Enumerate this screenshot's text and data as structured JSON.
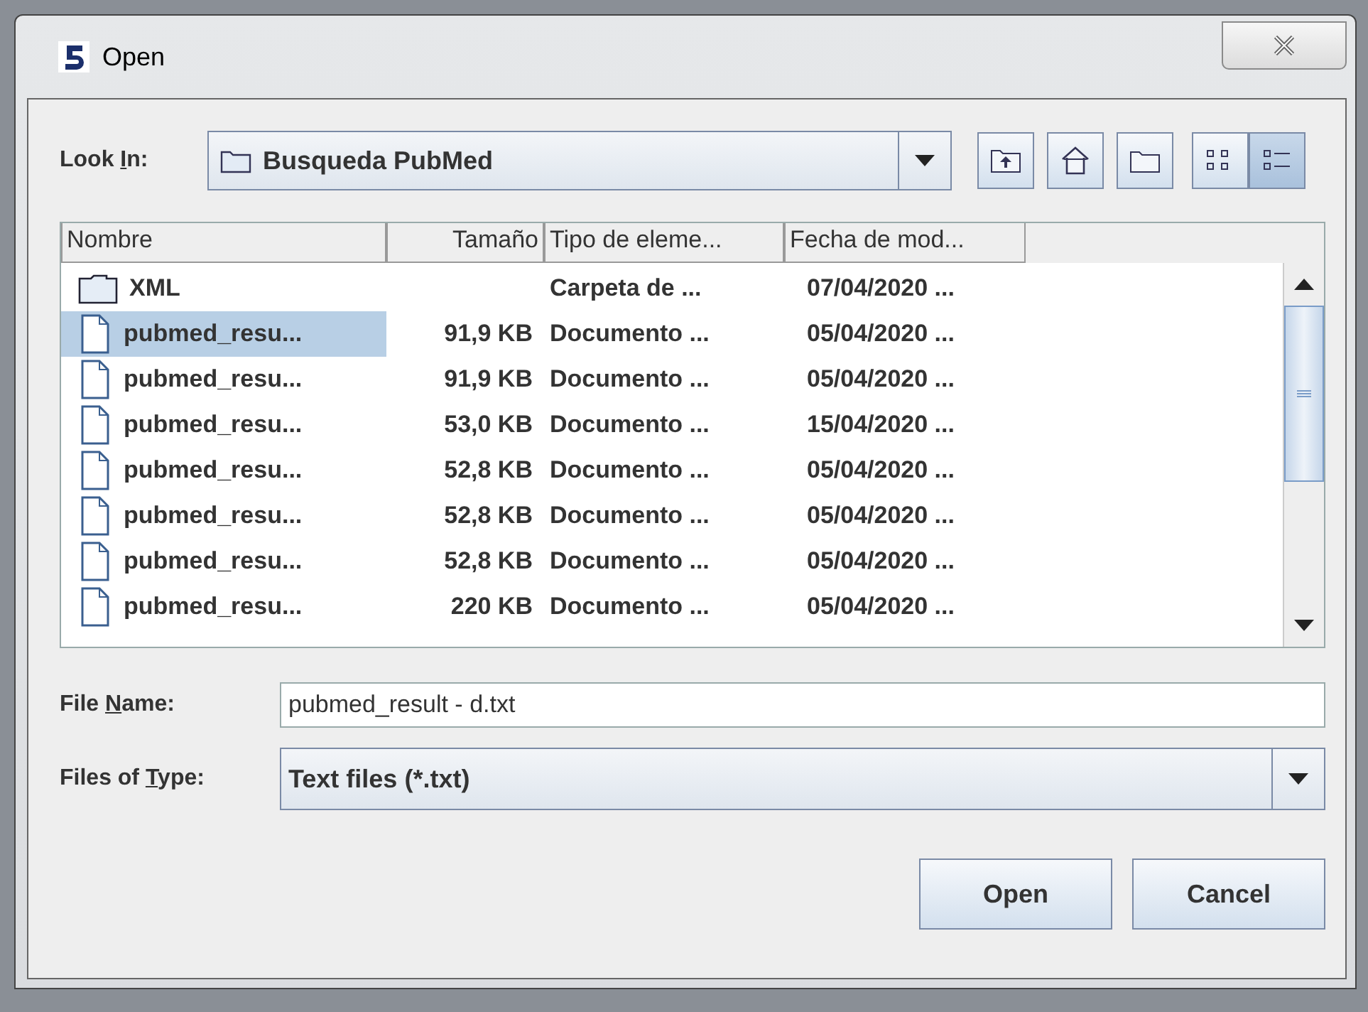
{
  "window": {
    "title": "Open"
  },
  "look_in": {
    "label_parts": [
      "Look ",
      "I",
      "n:"
    ],
    "value": "Busqueda PubMed"
  },
  "toolbar": [
    {
      "kind": "up",
      "selected": false
    },
    {
      "kind": "home",
      "selected": false
    },
    {
      "kind": "new-folder",
      "selected": false
    },
    {
      "kind": "list",
      "selected": false
    },
    {
      "kind": "details",
      "selected": true
    }
  ],
  "table": {
    "columns": [
      "Nombre",
      "Tamaño",
      "Tipo de eleme...",
      "Fecha de mod..."
    ],
    "rows": [
      {
        "kind": "folder",
        "name": "XML",
        "size": "",
        "type": "Carpeta de ...",
        "date": "07/04/2020 ...",
        "selected": false
      },
      {
        "kind": "file",
        "name": "pubmed_resu...",
        "size": "91,9 KB",
        "type": "Documento ...",
        "date": "05/04/2020 ...",
        "selected": true
      },
      {
        "kind": "file",
        "name": "pubmed_resu...",
        "size": "91,9 KB",
        "type": "Documento ...",
        "date": "05/04/2020 ...",
        "selected": false
      },
      {
        "kind": "file",
        "name": "pubmed_resu...",
        "size": "53,0 KB",
        "type": "Documento ...",
        "date": "15/04/2020 ...",
        "selected": false
      },
      {
        "kind": "file",
        "name": "pubmed_resu...",
        "size": "52,8 KB",
        "type": "Documento ...",
        "date": "05/04/2020 ...",
        "selected": false
      },
      {
        "kind": "file",
        "name": "pubmed_resu...",
        "size": "52,8 KB",
        "type": "Documento ...",
        "date": "05/04/2020 ...",
        "selected": false
      },
      {
        "kind": "file",
        "name": "pubmed_resu...",
        "size": "52,8 KB",
        "type": "Documento ...",
        "date": "05/04/2020 ...",
        "selected": false
      },
      {
        "kind": "file",
        "name": "pubmed_resu...",
        "size": "220 KB",
        "type": "Documento ...",
        "date": "05/04/2020 ...",
        "selected": false
      }
    ]
  },
  "file_name": {
    "label_parts": [
      "File ",
      "N",
      "ame:"
    ],
    "value": "pubmed_result - d.txt"
  },
  "file_type": {
    "label_parts": [
      "Files of ",
      "T",
      "ype:"
    ],
    "value": "Text files (*.txt)"
  },
  "buttons": [
    "Open",
    "Cancel"
  ]
}
